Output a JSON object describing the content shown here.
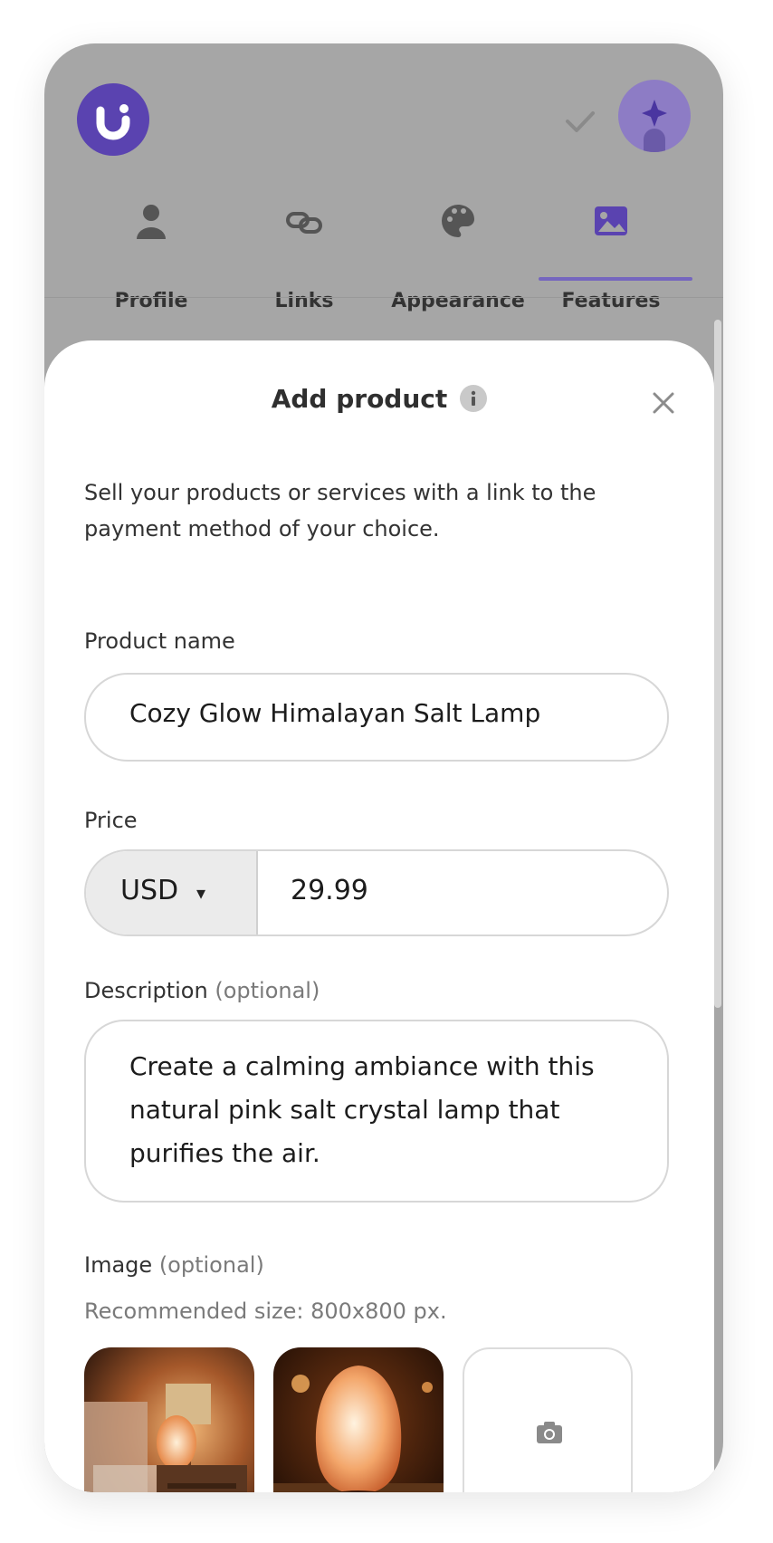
{
  "header": {
    "logo_icon": "brand-logo-icon",
    "check_icon": "check-icon",
    "avatar_icon": "ai-sparkle-avatar-icon"
  },
  "tabs": [
    {
      "label": "Profile",
      "icon": "person-icon"
    },
    {
      "label": "Links",
      "icon": "link-icon"
    },
    {
      "label": "Appearance",
      "icon": "palette-icon"
    },
    {
      "label": "Features",
      "icon": "image-icon",
      "active": true
    }
  ],
  "modal": {
    "title": "Add product",
    "intro": "Sell your products or services with a link to the payment method of your choice.",
    "product_name": {
      "label": "Product name",
      "value": "Cozy Glow Himalayan Salt Lamp"
    },
    "price": {
      "label": "Price",
      "currency": "USD",
      "caret": "▾",
      "amount": "29.99"
    },
    "description": {
      "label": "Description",
      "optional": "(optional)",
      "value": "Create a calming ambiance with this natural pink salt crystal lamp that purifies the air."
    },
    "image": {
      "label": "Image",
      "optional": "(optional)",
      "hint": "Recommended size: 800x800 px."
    }
  },
  "colors": {
    "accent": "#5a43b0",
    "overlay": "#a6a6a6",
    "tab_underline": "#7566bf"
  }
}
